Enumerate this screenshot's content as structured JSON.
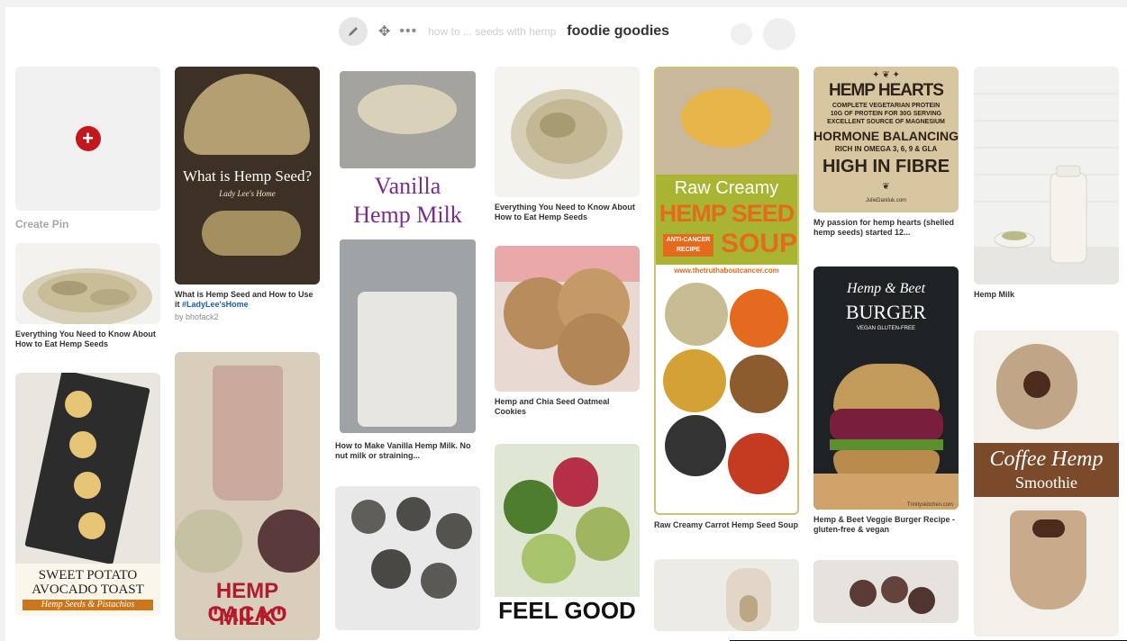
{
  "toolbar": {
    "edit_icon": "pencil-icon",
    "move_icon": "move-icon",
    "more_icon": "more-dots-icon",
    "faded_text": "how to ... seeds with hemp",
    "board_title": "foodie goodies"
  },
  "create_pin": {
    "label": "Create Pin"
  },
  "pins": {
    "c1_hemp_eat": {
      "caption": "Everything You Need to Know About How to Eat Hemp Seeds"
    },
    "c1_toast": {
      "line1": "SWEET POTATO",
      "line2": "AVOCADO TOAST",
      "line3": "Hemp Seeds & Pistachios"
    },
    "c2_what_is": {
      "overlay": "What is Hemp Seed?",
      "overlay2": "Lady Lee's Home",
      "caption": "What is Hemp Seed and How to Use it",
      "hashtag": "#LadyLee'sHome",
      "by": "by bhofack2"
    },
    "c2_cacao": {
      "line1": "HEMP CACAO",
      "line2": "\"MILK\""
    },
    "c3_vanilla": {
      "line1": "Vanilla",
      "line2": "Hemp Milk",
      "caption": "How to Make Vanilla Hemp Milk. No nut milk or straining..."
    },
    "c4_eat_hemp": {
      "caption": "Everything You Need to Know About How to Eat Hemp Seeds"
    },
    "c4_cookies": {
      "caption": "Hemp and Chia Seed Oatmeal Cookies"
    },
    "c4_feel": {
      "overlay": "FEEL GOOD"
    },
    "c5_soup": {
      "line1": "Raw Creamy",
      "line2": "HEMP SEED",
      "line3": "SOUP",
      "badge": "ANTI-CANCER RECIPE",
      "url": "www.thetruthaboutcancer.com",
      "caption": "Raw Creamy Carrot Hemp Seed Soup"
    },
    "c6_hearts": {
      "title": "HEMP HEARTS",
      "l1": "COMPLETE VEGETARIAN PROTEIN",
      "l2": "10G OF PROTEIN FOR 30G SERVING",
      "l3": "EXCELLENT SOURCE OF MAGNESIUM",
      "l4": "HORMONE BALANCING",
      "l5": "RICH IN OMEGA 3, 6, 9 & GLA",
      "l6": "HIGH IN FIBRE",
      "site": "JulieDaniluk.com",
      "caption": "My passion for hemp hearts (shelled hemp seeds) started 12..."
    },
    "c6_burger": {
      "l1": "Hemp & Beet",
      "l2": "BURGER",
      "l3": "VEGAN   GLUTEN-FREE",
      "site": "Trinityskitchen.com",
      "caption": "Hemp & Beet Veggie Burger Recipe - gluten-free & vegan"
    },
    "c7_milk": {
      "caption": "Hemp Milk"
    },
    "c7_coffee": {
      "l1": "Coffee Hemp",
      "l2": "Smoothie"
    }
  }
}
